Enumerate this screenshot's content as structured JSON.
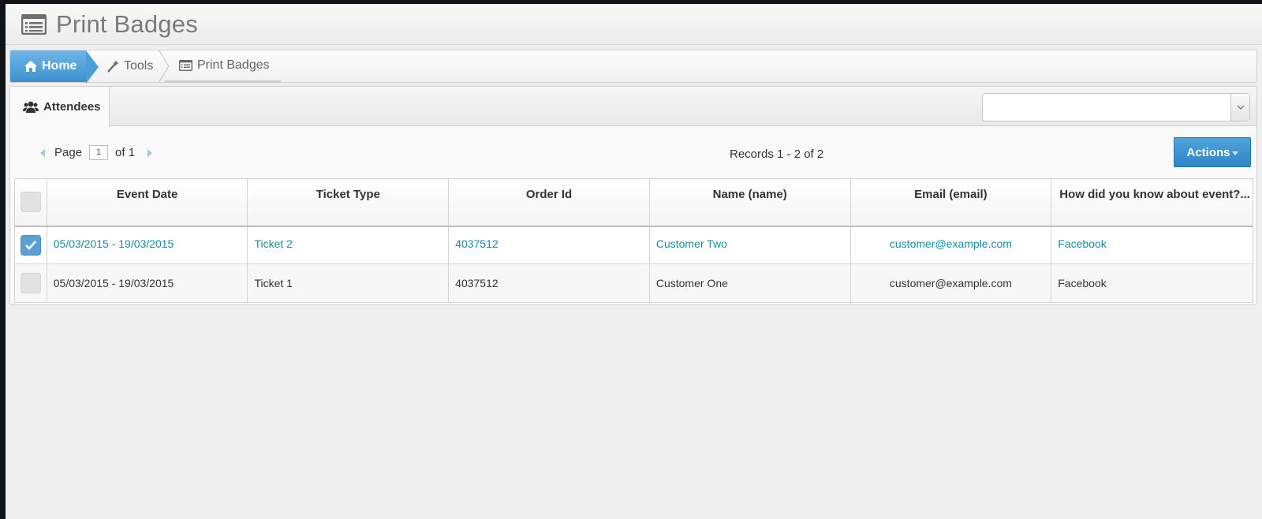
{
  "header": {
    "title": "Print Badges",
    "icon": "list-icon"
  },
  "breadcrumb": {
    "items": [
      {
        "label": "Home",
        "icon": "home-icon"
      },
      {
        "label": "Tools",
        "icon": "wand-icon"
      },
      {
        "label": "Print Badges",
        "icon": "list-icon"
      }
    ]
  },
  "tabs": [
    {
      "label": "Attendees",
      "icon": "users-icon",
      "active": true
    }
  ],
  "filter_select": {
    "value": ""
  },
  "pager": {
    "page_label": "Page",
    "page_value": "1",
    "of_label": "of 1"
  },
  "records_text": "Records 1 - 2 of 2",
  "actions_label": "Actions",
  "grid": {
    "columns": [
      "Event Date",
      "Ticket Type",
      "Order Id",
      "Name (name)",
      "Email (email)",
      "How did you know about event?..."
    ],
    "rows": [
      {
        "selected": true,
        "cells": [
          "05/03/2015  - 19/03/2015",
          "Ticket 2",
          "4037512",
          "Customer Two",
          "customer@example.com",
          "Facebook"
        ]
      },
      {
        "selected": false,
        "cells": [
          "05/03/2015  - 19/03/2015",
          "Ticket 1",
          "4037512",
          "Customer One",
          "customer@example.com",
          "Facebook"
        ]
      }
    ]
  },
  "colors": {
    "accent": "#3d91cf",
    "link": "#1a8ca3",
    "title": "#7a7a7a"
  }
}
